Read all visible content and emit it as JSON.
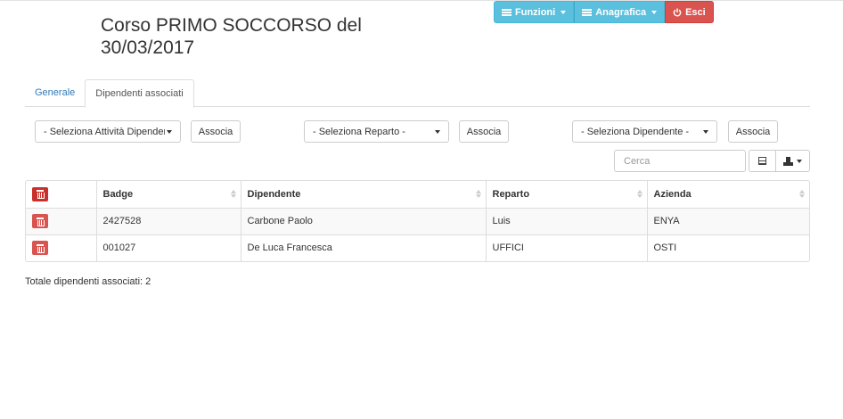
{
  "nav": {
    "funzioni_label": "Funzioni",
    "anagrafica_label": "Anagrafica",
    "esci_label": "Esci"
  },
  "page": {
    "title": "Corso PRIMO SOCCORSO del 30/03/2017"
  },
  "tabs": [
    {
      "label": "Generale",
      "active": false
    },
    {
      "label": "Dipendenti associati",
      "active": true
    }
  ],
  "selectors": {
    "attivita": "- Seleziona Attività Dipender",
    "reparto": "- Seleziona Reparto -",
    "dipendente": "- Seleziona Dipendente -",
    "associa_label": "Associa"
  },
  "search": {
    "placeholder": "Cerca"
  },
  "table": {
    "columns": [
      "",
      "Badge",
      "Dipendente",
      "Reparto",
      "Azienda"
    ],
    "rows": [
      {
        "badge": "2427528",
        "dipendente": "Carbone Paolo",
        "reparto": "Luis",
        "azienda": "ENYA"
      },
      {
        "badge": "001027",
        "dipendente": "De Luca Francesca",
        "reparto": "UFFICI",
        "azienda": "OSTI"
      }
    ]
  },
  "footer": {
    "total_text": "Totale dipendenti associati: 2"
  },
  "colors": {
    "info": "#5bc0de",
    "danger": "#d9534f",
    "link": "#337ab7"
  }
}
